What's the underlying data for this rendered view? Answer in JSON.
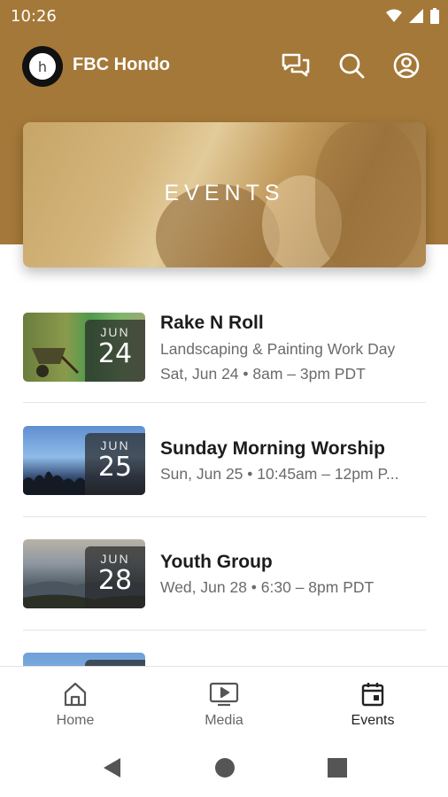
{
  "status_bar": {
    "time": "10:26"
  },
  "header": {
    "app_title": "FBC Hondo",
    "logo_letter": "h"
  },
  "hero": {
    "title": "EVENTS"
  },
  "events": [
    {
      "month": "JUN",
      "day": "24",
      "title": "Rake N Roll",
      "subtitle": "Landscaping & Painting Work Day",
      "when": "Sat, Jun 24 • 8am – 3pm PDT"
    },
    {
      "month": "JUN",
      "day": "25",
      "title": "Sunday Morning Worship",
      "when": "Sun, Jun 25 • 10:45am – 12pm P..."
    },
    {
      "month": "JUN",
      "day": "28",
      "title": "Youth Group",
      "when": "Wed, Jun 28 • 6:30 – 8pm PDT"
    }
  ],
  "bottom_nav": {
    "items": [
      {
        "label": "Home",
        "icon": "home-icon"
      },
      {
        "label": "Media",
        "icon": "media-icon"
      },
      {
        "label": "Events",
        "icon": "calendar-icon",
        "active": true
      }
    ]
  },
  "colors": {
    "brand": "#a47838",
    "active_nav": "#222222"
  }
}
